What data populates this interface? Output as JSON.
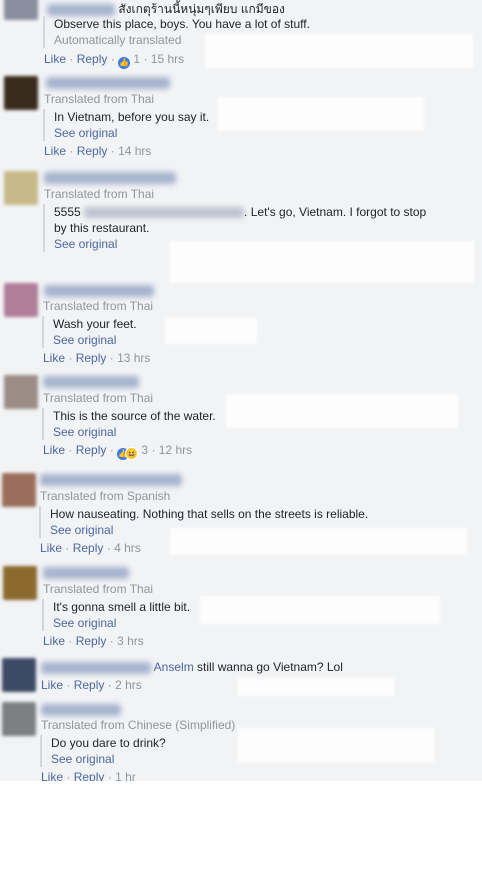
{
  "comments": [
    {
      "header_text": "สังเกตุร้านนี้หนุ่มๆเพียบ แกมีของ",
      "lines": [
        "Observe this place, boys. You have a lot of stuff."
      ],
      "auto_label": "Automatically translated",
      "like": "Like",
      "reply": "Reply",
      "reaction_count": "1",
      "time": "15 hrs"
    },
    {
      "translated_from": "Translated from Thai",
      "lines": [
        "In Vietnam, before you say it."
      ],
      "see_original": "See original",
      "like": "Like",
      "reply": "Reply",
      "time": "14 hrs"
    },
    {
      "translated_from": "Translated from Thai",
      "line1_start": "5555",
      "line1_end": ". Let's go, Vietnam. I forgot to stop",
      "line2": "by this restaurant.",
      "see_original": "See original"
    },
    {
      "translated_from": "Translated from Thai",
      "lines": [
        "Wash your feet."
      ],
      "see_original": "See original",
      "like": "Like",
      "reply": "Reply",
      "time": "13 hrs"
    },
    {
      "translated_from": "Translated from Thai",
      "lines": [
        "This is the source of the water."
      ],
      "see_original": "See original",
      "like": "Like",
      "reply": "Reply",
      "reaction_count": "3",
      "time": "12 hrs"
    },
    {
      "translated_from": "Translated from Spanish",
      "lines": [
        "How nauseating. Nothing that sells on the streets is reliable."
      ],
      "see_original": "See original",
      "like": "Like",
      "reply": "Reply",
      "time": "4 hrs"
    },
    {
      "translated_from": "Translated from Thai",
      "lines": [
        "It's gonna smell a little bit."
      ],
      "see_original": "See original",
      "like": "Like",
      "reply": "Reply",
      "time": "3 hrs"
    },
    {
      "tag": "Anselm",
      "text": " still wanna go Vietnam? Lol",
      "like": "Like",
      "reply": "Reply",
      "time": "2 hrs"
    },
    {
      "translated_from": "Translated from Chinese (Simplified)",
      "lines": [
        "Do you dare to drink?"
      ],
      "see_original": "See original",
      "like": "Like",
      "reply": "Reply",
      "time": "1 hr"
    }
  ],
  "colors": {
    "link": "#4b67a1",
    "meta": "#90949c",
    "feed_bg": "#f2f3f5",
    "like_reaction": "#3b79f4",
    "haha_reaction": "#f7c83a"
  },
  "separator": "·"
}
